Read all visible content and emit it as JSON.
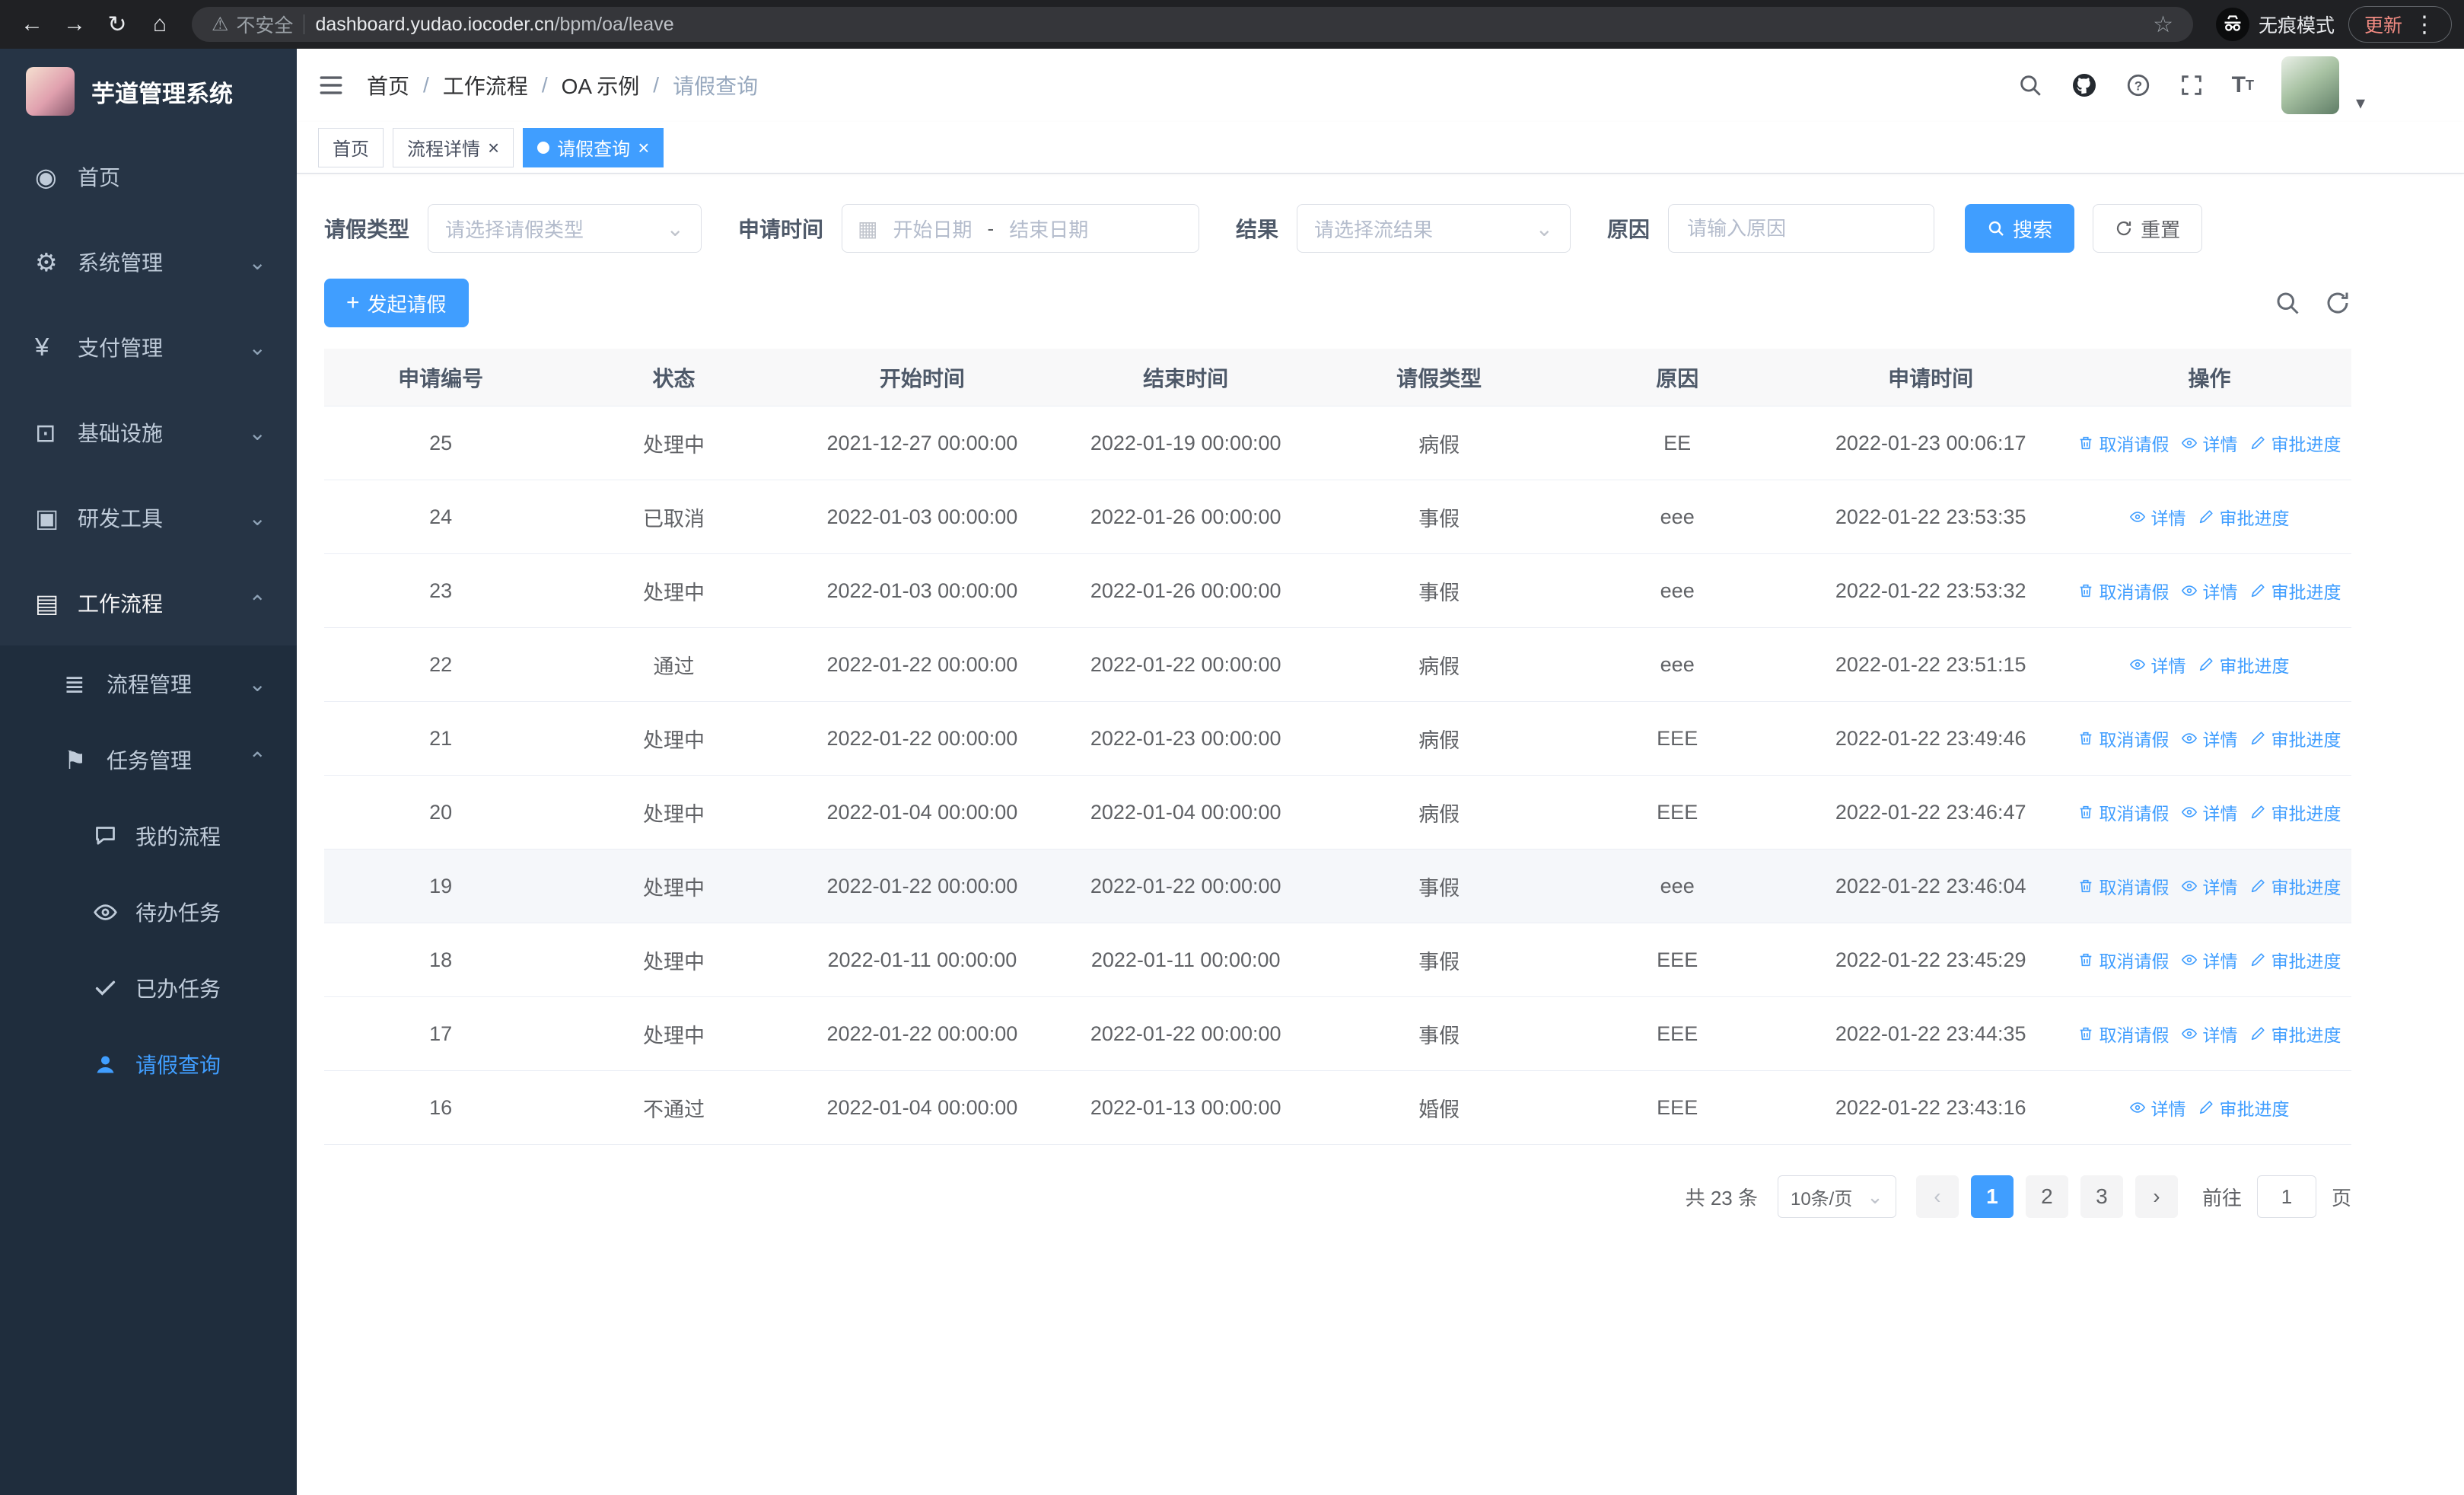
{
  "chrome": {
    "security_label": "不安全",
    "url_domain": "dashboard.yudao.iocoder.cn",
    "url_path": "/bpm/oa/leave",
    "incognito_label": "无痕模式",
    "update_label": "更新"
  },
  "icons": {
    "back": "←",
    "forward": "→",
    "reload": "↻",
    "home": "⌂",
    "warning": "⚠",
    "star": "☆",
    "more": "⋮",
    "caret-down": "⌄",
    "caret-up": "⌃",
    "avatar-caret": "▾",
    "calendar": "▦",
    "active-dot": "●",
    "close": "×",
    "plus": "+"
  },
  "sidebar": {
    "title": "芋道管理系统",
    "items": [
      {
        "name": "home",
        "label": "首页",
        "icon": "dashboard-icon",
        "level": 1
      },
      {
        "name": "system",
        "label": "系统管理",
        "icon": "gear-icon",
        "level": 1,
        "expandable": true
      },
      {
        "name": "payment",
        "label": "支付管理",
        "icon": "yen-icon",
        "level": 1,
        "expandable": true
      },
      {
        "name": "infrastructure",
        "label": "基础设施",
        "icon": "monitor-icon",
        "level": 1,
        "expandable": true
      },
      {
        "name": "devtools",
        "label": "研发工具",
        "icon": "toolbox-icon",
        "level": 1,
        "expandable": true
      },
      {
        "name": "workflow",
        "label": "工作流程",
        "icon": "workflow-icon",
        "level": 1,
        "expandable": true,
        "expanded": true
      },
      {
        "name": "process-mgmt",
        "label": "流程管理",
        "icon": "list-icon",
        "level": 2,
        "expandable": true
      },
      {
        "name": "task-mgmt",
        "label": "任务管理",
        "icon": "flag-icon",
        "level": 2,
        "expandable": true,
        "expanded": true
      },
      {
        "name": "my-process",
        "label": "我的流程",
        "icon": "chat-icon",
        "level": 3
      },
      {
        "name": "todo-task",
        "label": "待办任务",
        "icon": "eye-icon",
        "level": 3
      },
      {
        "name": "done-task",
        "label": "已办任务",
        "icon": "check-icon",
        "level": 3
      },
      {
        "name": "leave-query",
        "label": "请假查询",
        "icon": "user-icon",
        "level": 3,
        "active": true
      }
    ]
  },
  "header": {
    "breadcrumb": [
      "首页",
      "工作流程",
      "OA 示例",
      "请假查询"
    ],
    "separator": "/"
  },
  "tabs": [
    {
      "name": "home",
      "label": "首页"
    },
    {
      "name": "process-detail",
      "label": "流程详情",
      "closable": true
    },
    {
      "name": "leave-query",
      "label": "请假查询",
      "closable": true,
      "active": true
    }
  ],
  "filters": {
    "leave_type_label": "请假类型",
    "leave_type_placeholder": "请选择请假类型",
    "apply_time_label": "申请时间",
    "date_start_placeholder": "开始日期",
    "date_separator": "-",
    "date_end_placeholder": "结束日期",
    "result_label": "结果",
    "result_placeholder": "请选择流结果",
    "reason_label": "原因",
    "reason_placeholder": "请输入原因",
    "search_label": "搜索",
    "reset_label": "重置"
  },
  "toolbar": {
    "create_label": "发起请假"
  },
  "table": {
    "columns": [
      "申请编号",
      "状态",
      "开始时间",
      "结束时间",
      "请假类型",
      "原因",
      "申请时间",
      "操作"
    ],
    "op_labels": {
      "cancel": "取消请假",
      "detail": "详情",
      "progress": "审批进度"
    },
    "rows": [
      {
        "id": "25",
        "status": "处理中",
        "start": "2021-12-27 00:00:00",
        "end": "2022-01-19 00:00:00",
        "type": "病假",
        "reason": "EE",
        "applied": "2022-01-23 00:06:17",
        "ops": [
          "cancel",
          "detail",
          "progress"
        ]
      },
      {
        "id": "24",
        "status": "已取消",
        "start": "2022-01-03 00:00:00",
        "end": "2022-01-26 00:00:00",
        "type": "事假",
        "reason": "eee",
        "applied": "2022-01-22 23:53:35",
        "ops": [
          "detail",
          "progress"
        ]
      },
      {
        "id": "23",
        "status": "处理中",
        "start": "2022-01-03 00:00:00",
        "end": "2022-01-26 00:00:00",
        "type": "事假",
        "reason": "eee",
        "applied": "2022-01-22 23:53:32",
        "ops": [
          "cancel",
          "detail",
          "progress"
        ]
      },
      {
        "id": "22",
        "status": "通过",
        "start": "2022-01-22 00:00:00",
        "end": "2022-01-22 00:00:00",
        "type": "病假",
        "reason": "eee",
        "applied": "2022-01-22 23:51:15",
        "ops": [
          "detail",
          "progress"
        ]
      },
      {
        "id": "21",
        "status": "处理中",
        "start": "2022-01-22 00:00:00",
        "end": "2022-01-23 00:00:00",
        "type": "病假",
        "reason": "EEE",
        "applied": "2022-01-22 23:49:46",
        "ops": [
          "cancel",
          "detail",
          "progress"
        ]
      },
      {
        "id": "20",
        "status": "处理中",
        "start": "2022-01-04 00:00:00",
        "end": "2022-01-04 00:00:00",
        "type": "病假",
        "reason": "EEE",
        "applied": "2022-01-22 23:46:47",
        "ops": [
          "cancel",
          "detail",
          "progress"
        ]
      },
      {
        "id": "19",
        "status": "处理中",
        "start": "2022-01-22 00:00:00",
        "end": "2022-01-22 00:00:00",
        "type": "事假",
        "reason": "eee",
        "applied": "2022-01-22 23:46:04",
        "ops": [
          "cancel",
          "detail",
          "progress"
        ],
        "highlight": true
      },
      {
        "id": "18",
        "status": "处理中",
        "start": "2022-01-11 00:00:00",
        "end": "2022-01-11 00:00:00",
        "type": "事假",
        "reason": "EEE",
        "applied": "2022-01-22 23:45:29",
        "ops": [
          "cancel",
          "detail",
          "progress"
        ]
      },
      {
        "id": "17",
        "status": "处理中",
        "start": "2022-01-22 00:00:00",
        "end": "2022-01-22 00:00:00",
        "type": "事假",
        "reason": "EEE",
        "applied": "2022-01-22 23:44:35",
        "ops": [
          "cancel",
          "detail",
          "progress"
        ]
      },
      {
        "id": "16",
        "status": "不通过",
        "start": "2022-01-04 00:00:00",
        "end": "2022-01-13 00:00:00",
        "type": "婚假",
        "reason": "EEE",
        "applied": "2022-01-22 23:43:16",
        "ops": [
          "detail",
          "progress"
        ]
      }
    ]
  },
  "pagination": {
    "total_label": "共 23 条",
    "page_size_label": "10条/页",
    "pages": [
      "1",
      "2",
      "3"
    ],
    "active_page": "1",
    "prev_icon": "‹",
    "next_icon": "›",
    "goto_label": "前往",
    "goto_value": "1",
    "page_unit": "页"
  }
}
